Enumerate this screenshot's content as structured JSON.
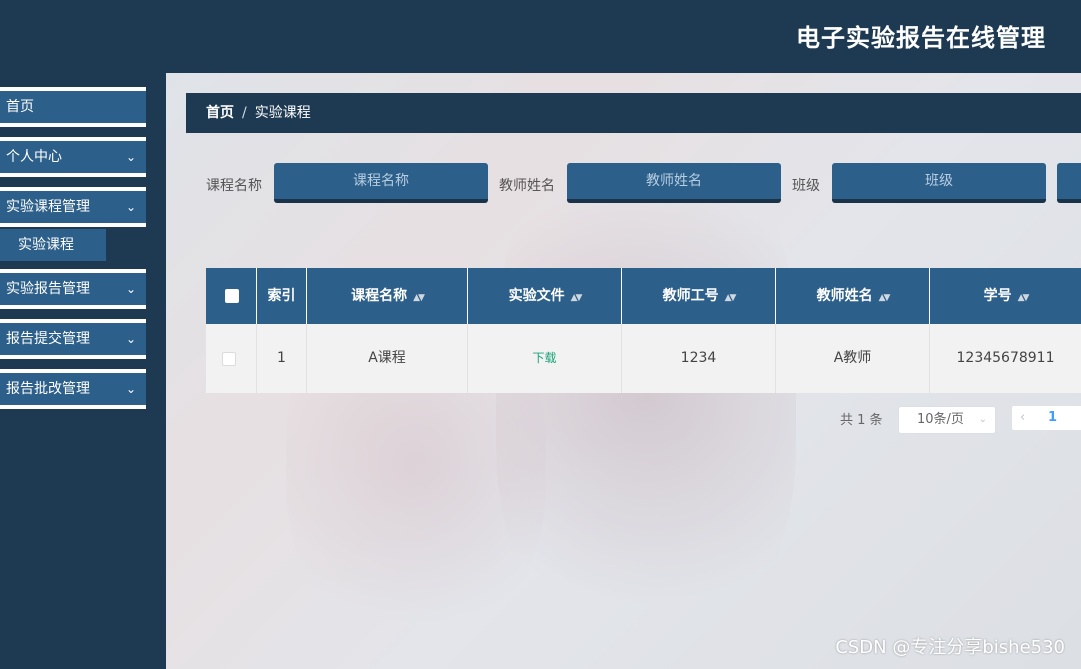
{
  "header": {
    "title": "电子实验报告在线管理"
  },
  "sidebar": {
    "items": [
      {
        "label": "首页",
        "chevron": ""
      },
      {
        "label": "个人中心",
        "chevron": "⌄"
      },
      {
        "label": "实验课程管理",
        "chevron": "⌄"
      },
      {
        "label": "实验报告管理",
        "chevron": "⌄"
      },
      {
        "label": "报告提交管理",
        "chevron": "⌄"
      },
      {
        "label": "报告批改管理",
        "chevron": "⌄"
      }
    ],
    "submenu": {
      "label": "实验课程"
    }
  },
  "breadcrumb": {
    "home": "首页",
    "separator": "/",
    "current": "实验课程"
  },
  "search": {
    "course_label": "课程名称",
    "course_placeholder": "课程名称",
    "teacher_label": "教师姓名",
    "teacher_placeholder": "教师姓名",
    "class_label": "班级",
    "class_placeholder": "班级"
  },
  "table": {
    "headers": {
      "index": "索引",
      "course": "课程名称",
      "file": "实验文件",
      "teacher_id": "教师工号",
      "teacher_name": "教师姓名",
      "student_id": "学号"
    },
    "sort_icon": "▲▼",
    "rows": [
      {
        "index": "1",
        "course": "A课程",
        "file": "下载",
        "teacher_id": "1234",
        "teacher_name": "A教师",
        "student_id": "12345678911"
      }
    ]
  },
  "pager": {
    "total": "共 1 条",
    "size": "10条/页",
    "prev": "‹",
    "page": "1",
    "next": "›",
    "caret": "⌄"
  },
  "watermark": "CSDN @专注分享bishe530"
}
